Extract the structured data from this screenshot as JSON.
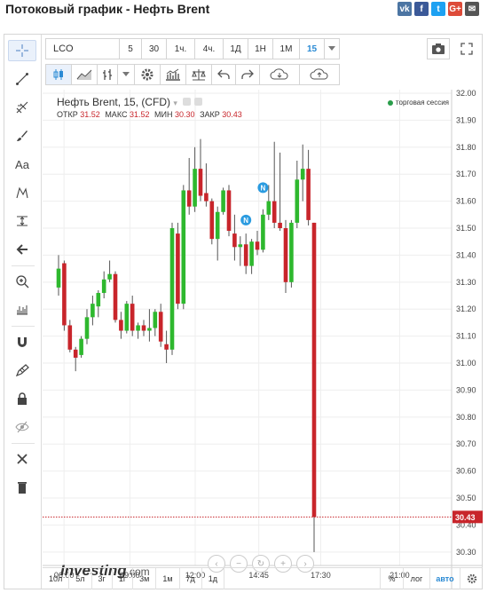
{
  "page": {
    "title": "Потоковый график - Нефть Brent"
  },
  "share": [
    {
      "icon": "vk-icon",
      "label": "vk",
      "color": "#4c75a3"
    },
    {
      "icon": "facebook-icon",
      "label": "f",
      "color": "#3b5998"
    },
    {
      "icon": "twitter-icon",
      "label": "t",
      "color": "#1da1f2"
    },
    {
      "icon": "googleplus-icon",
      "label": "G+",
      "color": "#dd4b39"
    },
    {
      "icon": "email-icon",
      "label": "✉",
      "color": "#555555"
    }
  ],
  "topbar": {
    "symbol": "LCO",
    "intervals": [
      "5",
      "30",
      "1ч.",
      "4ч.",
      "1Д",
      "1Н",
      "1М",
      "15"
    ],
    "active_interval": "15"
  },
  "legend": {
    "title": "Нефть Brent, 15, (CFD)",
    "open_label": "ОТКР",
    "open": "31.52",
    "high_label": "МАКС",
    "high": "31.52",
    "low_label": "МИН",
    "low": "30.30",
    "close_label": "ЗАКР",
    "close": "30.43",
    "session": "торговая сессия"
  },
  "logo": {
    "brand": "Investing",
    "suffix": ".com"
  },
  "ranges": [
    "10л",
    "5л",
    "3г",
    "1г",
    "3м",
    "1м",
    "7д",
    "1д"
  ],
  "range_right": [
    "%",
    "лог",
    "авто"
  ],
  "range_active": "авто",
  "colors": {
    "up": "#2eb82e",
    "down": "#c8252b",
    "grid": "#eeeeee",
    "price_line": "#c8252b",
    "accent": "#2a8ad4"
  },
  "chart_data": {
    "type": "candlestick",
    "x_ticks": [
      "06:00",
      "09:00",
      "12:00",
      "14:45",
      "17:30",
      "21:00"
    ],
    "y_ticks": [
      "32.00",
      "31.90",
      "31.80",
      "31.70",
      "31.60",
      "31.50",
      "31.40",
      "31.30",
      "31.20",
      "31.10",
      "31.00",
      "30.90",
      "30.80",
      "30.70",
      "30.60",
      "30.50",
      "30.40",
      "30.30"
    ],
    "ylim": [
      30.26,
      32.0
    ],
    "current_price": "30.43",
    "candles": [
      {
        "o": 31.28,
        "h": 31.4,
        "l": 31.25,
        "c": 31.35
      },
      {
        "o": 31.37,
        "h": 31.38,
        "l": 31.12,
        "c": 31.14
      },
      {
        "o": 31.14,
        "h": 31.16,
        "l": 31.04,
        "c": 31.05
      },
      {
        "o": 31.05,
        "h": 31.06,
        "l": 30.97,
        "c": 31.02
      },
      {
        "o": 31.03,
        "h": 31.1,
        "l": 31.02,
        "c": 31.09
      },
      {
        "o": 31.09,
        "h": 31.2,
        "l": 31.07,
        "c": 31.17
      },
      {
        "o": 31.17,
        "h": 31.25,
        "l": 31.14,
        "c": 31.22
      },
      {
        "o": 31.21,
        "h": 31.27,
        "l": 31.17,
        "c": 31.26
      },
      {
        "o": 31.26,
        "h": 31.34,
        "l": 31.24,
        "c": 31.31
      },
      {
        "o": 31.31,
        "h": 31.38,
        "l": 31.3,
        "c": 31.33
      },
      {
        "o": 31.33,
        "h": 31.34,
        "l": 31.15,
        "c": 31.16
      },
      {
        "o": 31.16,
        "h": 31.19,
        "l": 31.09,
        "c": 31.12
      },
      {
        "o": 31.12,
        "h": 31.23,
        "l": 31.11,
        "c": 31.22
      },
      {
        "o": 31.22,
        "h": 31.25,
        "l": 31.1,
        "c": 31.12
      },
      {
        "o": 31.12,
        "h": 31.15,
        "l": 31.09,
        "c": 31.14
      },
      {
        "o": 31.14,
        "h": 31.16,
        "l": 31.1,
        "c": 31.12
      },
      {
        "o": 31.12,
        "h": 31.2,
        "l": 31.08,
        "c": 31.13
      },
      {
        "o": 31.13,
        "h": 31.2,
        "l": 31.1,
        "c": 31.19
      },
      {
        "o": 31.19,
        "h": 31.22,
        "l": 31.06,
        "c": 31.08
      },
      {
        "o": 31.07,
        "h": 31.12,
        "l": 31.0,
        "c": 31.05
      },
      {
        "o": 31.05,
        "h": 31.52,
        "l": 31.03,
        "c": 31.5
      },
      {
        "o": 31.48,
        "h": 31.52,
        "l": 31.2,
        "c": 31.22
      },
      {
        "o": 31.22,
        "h": 31.66,
        "l": 31.2,
        "c": 31.64
      },
      {
        "o": 31.64,
        "h": 31.76,
        "l": 31.55,
        "c": 31.58
      },
      {
        "o": 31.58,
        "h": 31.8,
        "l": 31.56,
        "c": 31.72
      },
      {
        "o": 31.72,
        "h": 31.83,
        "l": 31.6,
        "c": 31.62
      },
      {
        "o": 31.63,
        "h": 31.74,
        "l": 31.58,
        "c": 31.6
      },
      {
        "o": 31.6,
        "h": 31.61,
        "l": 31.44,
        "c": 31.46
      },
      {
        "o": 31.46,
        "h": 31.58,
        "l": 31.38,
        "c": 31.56
      },
      {
        "o": 31.56,
        "h": 31.65,
        "l": 31.55,
        "c": 31.64
      },
      {
        "o": 31.64,
        "h": 31.66,
        "l": 31.47,
        "c": 31.49
      },
      {
        "o": 31.48,
        "h": 31.55,
        "l": 31.38,
        "c": 31.43
      },
      {
        "o": 31.43,
        "h": 31.47,
        "l": 31.36,
        "c": 31.44
      },
      {
        "o": 31.44,
        "h": 31.48,
        "l": 31.33,
        "c": 31.36
      },
      {
        "o": 31.36,
        "h": 31.46,
        "l": 31.33,
        "c": 31.45
      },
      {
        "o": 31.45,
        "h": 31.49,
        "l": 31.4,
        "c": 31.42
      },
      {
        "o": 31.42,
        "h": 31.57,
        "l": 31.41,
        "c": 31.55
      },
      {
        "o": 31.55,
        "h": 31.66,
        "l": 31.53,
        "c": 31.6
      },
      {
        "o": 31.6,
        "h": 31.82,
        "l": 31.5,
        "c": 31.52
      },
      {
        "o": 31.52,
        "h": 31.78,
        "l": 31.49,
        "c": 31.5
      },
      {
        "o": 31.5,
        "h": 31.53,
        "l": 31.26,
        "c": 31.3
      },
      {
        "o": 31.3,
        "h": 31.53,
        "l": 31.28,
        "c": 31.52
      },
      {
        "o": 31.52,
        "h": 31.75,
        "l": 31.5,
        "c": 31.68
      },
      {
        "o": 31.68,
        "h": 31.81,
        "l": 31.6,
        "c": 31.72
      },
      {
        "o": 31.72,
        "h": 31.79,
        "l": 31.51,
        "c": 31.53
      },
      {
        "o": 31.52,
        "h": 31.52,
        "l": 30.3,
        "c": 30.43
      }
    ],
    "markers": [
      {
        "label": "N",
        "index": 36,
        "price": 31.65
      },
      {
        "label": "N",
        "index": 33,
        "price": 31.53
      }
    ]
  }
}
